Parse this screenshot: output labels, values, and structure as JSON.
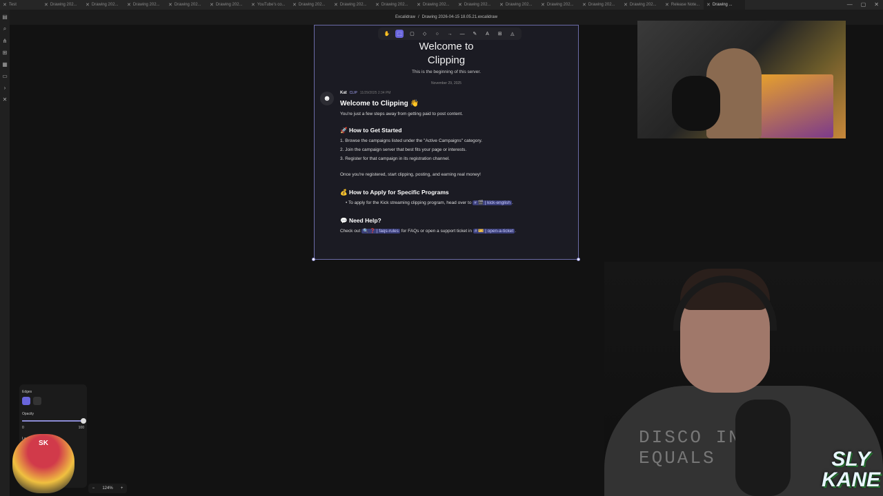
{
  "tabs": [
    {
      "label": "Test",
      "active": false
    },
    {
      "label": "Drawing 202...",
      "active": false
    },
    {
      "label": "Drawing 202...",
      "active": false
    },
    {
      "label": "Drawing 202...",
      "active": false
    },
    {
      "label": "Drawing 202...",
      "active": false
    },
    {
      "label": "Drawing 202...",
      "active": false
    },
    {
      "label": "YouTube's co...",
      "active": false
    },
    {
      "label": "Drawing 202...",
      "active": false
    },
    {
      "label": "Drawing 202...",
      "active": false
    },
    {
      "label": "Drawing 202...",
      "active": false
    },
    {
      "label": "Drawing 202...",
      "active": false
    },
    {
      "label": "Drawing 202...",
      "active": false
    },
    {
      "label": "Drawing 202...",
      "active": false
    },
    {
      "label": "Drawing 202...",
      "active": false
    },
    {
      "label": "Drawing 202...",
      "active": false
    },
    {
      "label": "Drawing 202...",
      "active": false
    },
    {
      "label": "Release Note...",
      "active": false
    },
    {
      "label": "Drawing ...",
      "active": true
    }
  ],
  "titlebar": {
    "app": "Excalidraw",
    "separator": "/",
    "file": "Drawing 2026-04-15 18.05.21.excalidraw"
  },
  "toolbar": {
    "tools": [
      "✋",
      "⬚",
      "▢",
      "◇",
      "○",
      "→",
      "—",
      "✎",
      "A",
      "⊞",
      "◬"
    ],
    "selected_index": 1
  },
  "card": {
    "title_line1": "Welcome to",
    "title_line2": "Clipping",
    "subtitle": "This is the beginning of this server.",
    "date": "November 29, 2025"
  },
  "message": {
    "author": "Kat",
    "tag": "CLIP",
    "timestamp": "11/29/2025 2:34 PM",
    "heading": "Welcome to Clipping 👋",
    "intro": "You're just a few steps away from getting paid to post content.",
    "started_heading": "🚀 How to Get Started",
    "steps": [
      "1. Browse the campaigns listed under the \"Active Campaigns\" category.",
      "2. Join the campaign server that best fits your page or interests.",
      "3. Register for that campaign in its registration channel."
    ],
    "closing": "Once you're registered, start clipping, posting, and earning real money!",
    "apply_heading": "💰 How to Apply for Specific Programs",
    "apply_text": "To apply for the Kick streaming clipping program, head over to",
    "apply_mention": "# 🎬 | kick-english",
    "help_heading": "💬 Need Help?",
    "help_prefix": "Check out",
    "help_mention1": "🔍 ❓ | faqs-rules",
    "help_middle": "for FAQs or open a support ticket in",
    "help_mention2": "# 🎫 | open-a-ticket"
  },
  "properties": {
    "edges_label": "Edges",
    "opacity_label": "Opacity",
    "opacity_min": "0",
    "opacity_max": "100",
    "opacity_value": 1.0,
    "layers_label": "Layers"
  },
  "zoom": {
    "minus": "−",
    "value": "124%",
    "plus": "+"
  },
  "overlay": {
    "badge_text": "SK",
    "logo_line1": "SLY",
    "logo_line2": "KANE",
    "shirt_line1": "DISCO IN",
    "shirt_line2": "EQUALS"
  },
  "colors": {
    "accent": "#6965db",
    "card_bg": "#1b1b23",
    "canvas_bg": "#121212"
  }
}
